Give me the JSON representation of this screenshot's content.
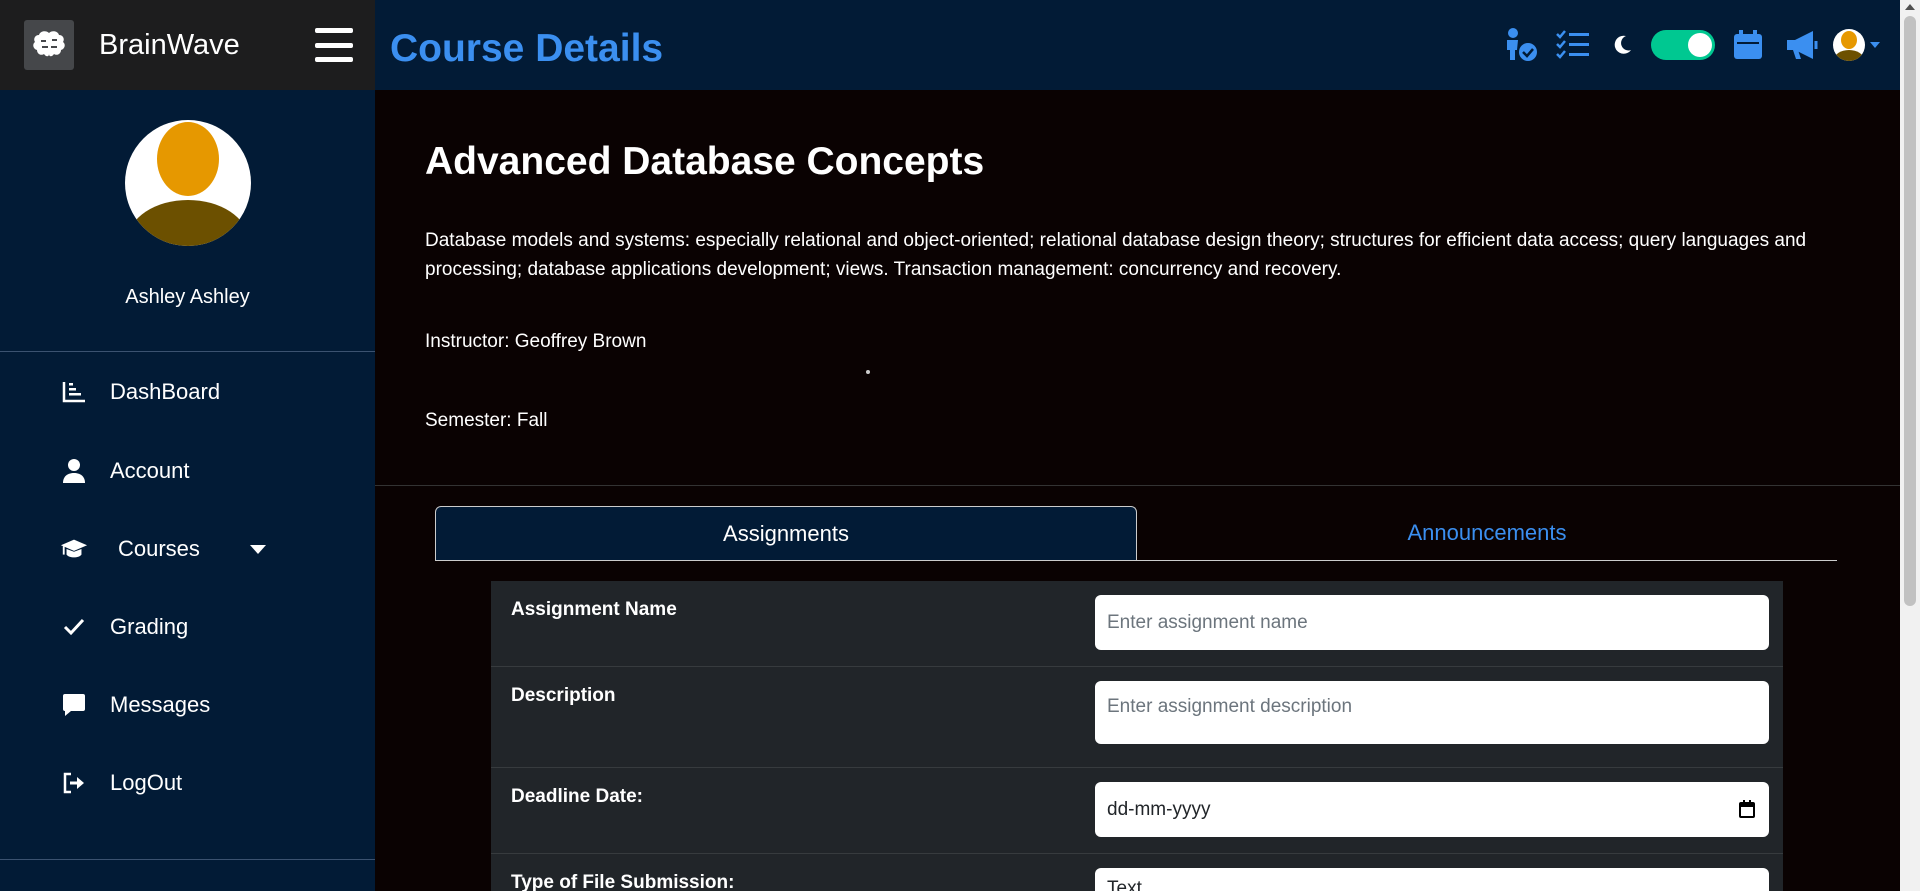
{
  "brand": {
    "name": "BrainWave",
    "logo_icon": "brain-icon"
  },
  "profile": {
    "name": "Ashley Ashley"
  },
  "nav": [
    {
      "label": "DashBoard",
      "icon": "chart-icon"
    },
    {
      "label": "Account",
      "icon": "user-icon"
    },
    {
      "label": "Courses",
      "icon": "graduation-cap-icon"
    },
    {
      "label": "Grading",
      "icon": "check-icon"
    },
    {
      "label": "Messages",
      "icon": "message-icon"
    },
    {
      "label": "LogOut",
      "icon": "logout-icon"
    }
  ],
  "header": {
    "title": "Course Details"
  },
  "course": {
    "title": "Advanced Database Concepts",
    "description": "Database models and systems: especially relational and object-oriented; relational database design theory; structures for efficient data access; query languages and processing; database applications development; views. Transaction management: concurrency and recovery.",
    "instructor": "Instructor: Geoffrey Brown",
    "semester": "Semester: Fall"
  },
  "tabs": {
    "assignments": "Assignments",
    "announcements": "Announcements"
  },
  "form": {
    "name_label": "Assignment Name",
    "name_placeholder": "Enter assignment name",
    "desc_label": "Description",
    "desc_placeholder": "Enter assignment description",
    "deadline_label": "Deadline Date:",
    "deadline_value": "dd-mm-yyyy",
    "filetype_label": "Type of File Submission:",
    "filetype_value": "Text"
  },
  "colors": {
    "accent": "#3b8ff0",
    "sidebar": "#021b36",
    "toggle": "#00c891",
    "avatar": "#e69800"
  }
}
